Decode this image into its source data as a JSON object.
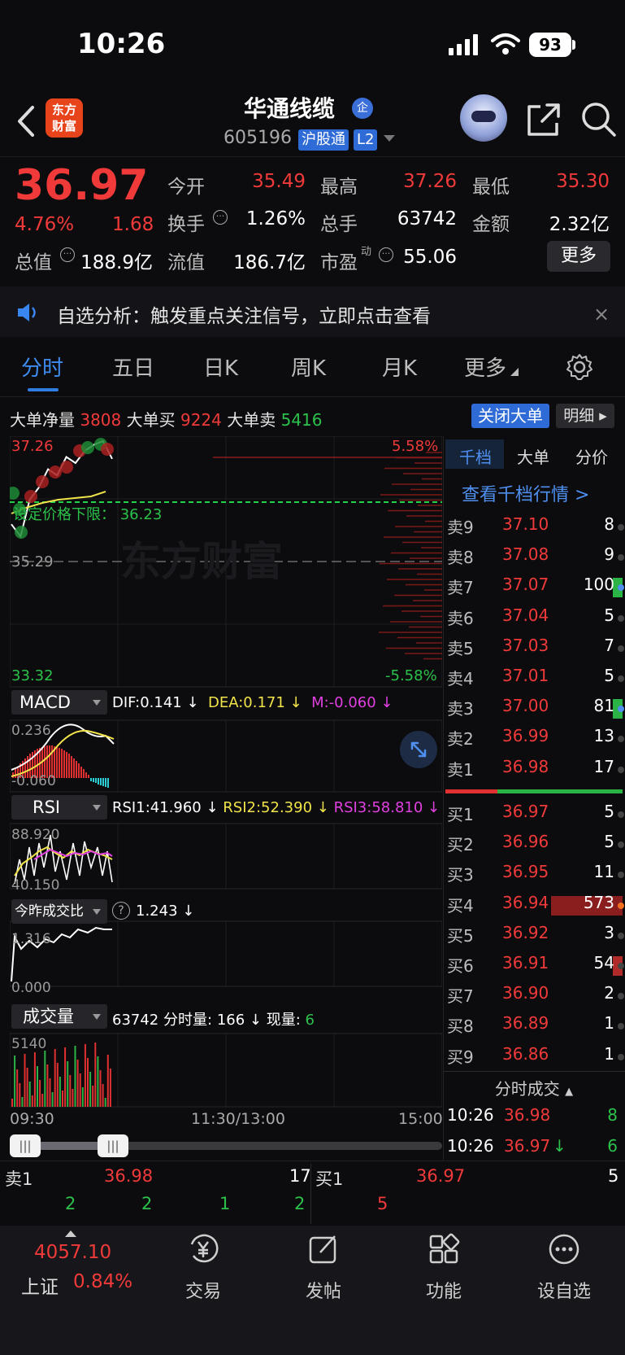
{
  "status_bar": {
    "time": "10:26",
    "battery": "93"
  },
  "header": {
    "logo": "东方\n财富",
    "name": "华通线缆",
    "ent_badge": "企",
    "code": "605196",
    "market": "沪股通",
    "level": "L2"
  },
  "quote": {
    "price": "36.97",
    "pct": "4.76%",
    "change": "1.68",
    "stats": [
      {
        "label": "今开",
        "value": "35.49",
        "color": "#f03a3a"
      },
      {
        "label": "最高",
        "value": "37.26",
        "color": "#f03a3a"
      },
      {
        "label": "最低",
        "value": "35.30",
        "color": "#f03a3a"
      },
      {
        "label": "换手",
        "value": "1.26%",
        "color": "#ffffff"
      },
      {
        "label": "总手",
        "value": "63742",
        "color": "#ffffff"
      },
      {
        "label": "金额",
        "value": "2.32亿",
        "color": "#ffffff"
      },
      {
        "label": "总值",
        "value": "188.9亿",
        "color": "#ffffff"
      },
      {
        "label": "流值",
        "value": "186.7亿",
        "color": "#ffffff"
      },
      {
        "label": "市盈",
        "label_sup": "动",
        "value": "55.06",
        "color": "#ffffff"
      }
    ],
    "more_label": "更多"
  },
  "alert": {
    "text": "自选分析：触发重点关注信号，立即点击查看",
    "close": "×"
  },
  "tabs": [
    "分时",
    "五日",
    "日K",
    "周K",
    "月K",
    "更多"
  ],
  "big_order": {
    "net_label": "大单净量",
    "net": "3808",
    "buy_label": "大单买",
    "buy": "9224",
    "sell_label": "大单卖",
    "sell": "5416",
    "close_button": "关闭大单",
    "detail_button": "明细"
  },
  "chart": {
    "price_high": "37.26",
    "price_low": "33.32",
    "prev_close": "35.29",
    "pct_high": "5.58%",
    "pct_low": "-5.58%",
    "watermark": "东方财富",
    "limit_label": "设定价格下限：",
    "limit_value": "36.23",
    "macd": {
      "name": "MACD",
      "dif": "DIF:0.141 ↓",
      "dea": "DEA:0.171 ↓",
      "m": "M:-0.060 ↓",
      "top": "0.236",
      "bottom": "-0.060"
    },
    "rsi": {
      "name": "RSI",
      "rsi1": "RSI1:41.960 ↓",
      "rsi2": "RSI2:52.390 ↓",
      "rsi3": "RSI3:58.810 ↓",
      "top": "88.920",
      "bottom": "40.150"
    },
    "ratio": {
      "name": "今昨成交比",
      "value": "1.243 ↓",
      "top": "1.316",
      "bottom": "0.000"
    },
    "volume": {
      "name": "成交量",
      "total": "63742",
      "minute_label": "分时量:",
      "minute": "166 ↓",
      "now_label": "现量:",
      "now": "6",
      "top": "5140"
    },
    "x_labels": [
      "09:30",
      "11:30/13:00",
      "15:00"
    ]
  },
  "chart_data": {
    "type": "line",
    "x": [
      "09:30",
      "09:35",
      "09:40",
      "09:45",
      "09:50",
      "09:55",
      "10:00",
      "10:05",
      "10:10",
      "10:15",
      "10:20",
      "10:26"
    ],
    "series": [
      {
        "values": [
          35.9,
          35.7,
          36.3,
          36.5,
          36.8,
          36.7,
          37.0,
          36.9,
          37.1,
          37.2,
          37.26,
          36.97
        ]
      }
    ],
    "ylim": [
      33.32,
      37.26
    ],
    "volume": [
      120,
      80,
      430,
      210,
      300,
      140,
      380,
      260,
      500,
      190,
      240,
      166
    ]
  },
  "orderbook": {
    "tabs": [
      "千档",
      "大单",
      "分价"
    ],
    "link": "查看千档行情 >",
    "asks": [
      {
        "label": "卖9",
        "price": "37.10",
        "vol": "8"
      },
      {
        "label": "卖8",
        "price": "37.08",
        "vol": "9"
      },
      {
        "label": "卖7",
        "price": "37.07",
        "vol": "100"
      },
      {
        "label": "卖6",
        "price": "37.04",
        "vol": "5"
      },
      {
        "label": "卖5",
        "price": "37.03",
        "vol": "7"
      },
      {
        "label": "卖4",
        "price": "37.01",
        "vol": "5"
      },
      {
        "label": "卖3",
        "price": "37.00",
        "vol": "81"
      },
      {
        "label": "卖2",
        "price": "36.99",
        "vol": "13"
      },
      {
        "label": "卖1",
        "price": "36.98",
        "vol": "17"
      }
    ],
    "bids": [
      {
        "label": "买1",
        "price": "36.97",
        "vol": "5"
      },
      {
        "label": "买2",
        "price": "36.96",
        "vol": "5"
      },
      {
        "label": "买3",
        "price": "36.95",
        "vol": "11"
      },
      {
        "label": "买4",
        "price": "36.94",
        "vol": "573"
      },
      {
        "label": "买5",
        "price": "36.92",
        "vol": "3"
      },
      {
        "label": "买6",
        "price": "36.91",
        "vol": "54"
      },
      {
        "label": "买7",
        "price": "36.90",
        "vol": "2"
      },
      {
        "label": "买8",
        "price": "36.89",
        "vol": "1"
      },
      {
        "label": "买9",
        "price": "36.86",
        "vol": "1"
      }
    ],
    "ts_header": "分时成交",
    "trades": [
      {
        "time": "10:26",
        "price": "36.98",
        "arrow": "",
        "vol": "8"
      },
      {
        "time": "10:26",
        "price": "36.97",
        "arrow": "↓",
        "vol": "6"
      }
    ]
  },
  "level_strip": {
    "sell_label": "卖1",
    "sell_price": "36.98",
    "sell_vol": "17",
    "buy_label": "买1",
    "buy_price": "36.97",
    "buy_vol": "5",
    "sell_queue": [
      "2",
      "2",
      "1",
      "2"
    ],
    "buy_queue": [
      "5"
    ]
  },
  "bottom_nav": {
    "index_value": "4057.10",
    "index_name": "上证",
    "index_pct": "0.84%",
    "items": [
      "交易",
      "发帖",
      "功能",
      "设自选"
    ]
  }
}
